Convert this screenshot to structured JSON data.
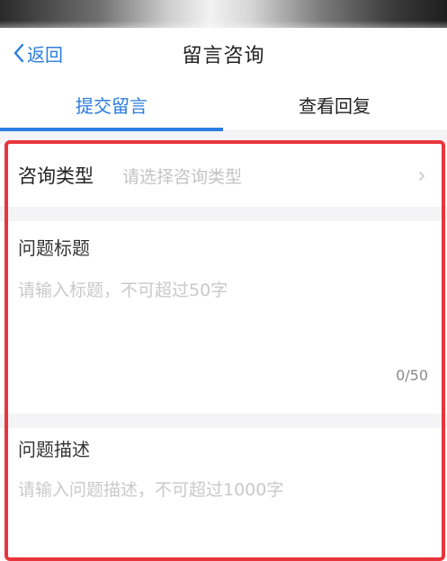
{
  "colors": {
    "accent": "#2b7de0",
    "highlight_border": "#e8353d",
    "placeholder": "#c4c4c4",
    "background_gap": "#f4f4f6"
  },
  "navbar": {
    "back_label": "返回",
    "title": "留言咨询"
  },
  "tabs": [
    {
      "label": "提交留言",
      "active": true
    },
    {
      "label": "查看回复",
      "active": false
    }
  ],
  "form": {
    "consult_type": {
      "label": "咨询类型",
      "placeholder": "请选择咨询类型",
      "chevron_icon": "chevron-right-icon"
    },
    "title_field": {
      "label": "问题标题",
      "placeholder": "请输入标题，不可超过50字",
      "counter": "0/50"
    },
    "description_field": {
      "label": "问题描述",
      "placeholder": "请输入问题描述，不可超过1000字"
    }
  }
}
